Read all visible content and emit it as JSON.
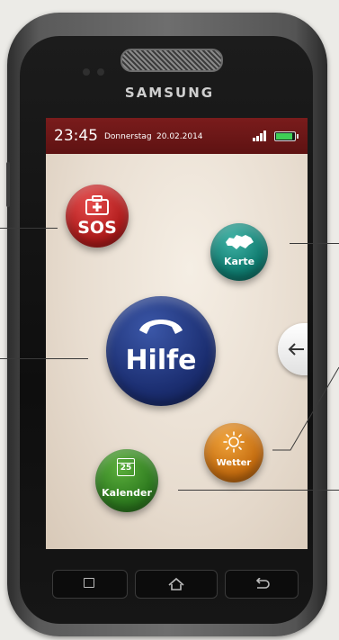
{
  "device": {
    "brand": "SAMSUNG"
  },
  "status_bar": {
    "time": "23:45",
    "day": "Donnerstag",
    "date": "20.02.2014",
    "battery_level": 1.0,
    "signal_bars": 4
  },
  "apps": {
    "sos": {
      "label": "SOS",
      "icon": "first-aid-kit-icon",
      "color": "#c02424"
    },
    "karte": {
      "label": "Karte",
      "icon": "swiss-map-icon",
      "color": "#138375"
    },
    "hilfe": {
      "label": "Hilfe",
      "icon": "phone-handset-icon",
      "color": "#223782"
    },
    "wetter": {
      "label": "Wetter",
      "icon": "sun-icon",
      "color": "#d97d17"
    },
    "kalender": {
      "label": "Kalender",
      "icon": "calendar-icon",
      "calendar_day": "25",
      "color": "#348324"
    }
  },
  "back_tab": {
    "icon": "arrow-left-icon"
  },
  "hardware_keys": {
    "menu": {
      "icon": "menu-icon"
    },
    "home": {
      "icon": "home-icon"
    },
    "back": {
      "icon": "back-icon"
    }
  }
}
